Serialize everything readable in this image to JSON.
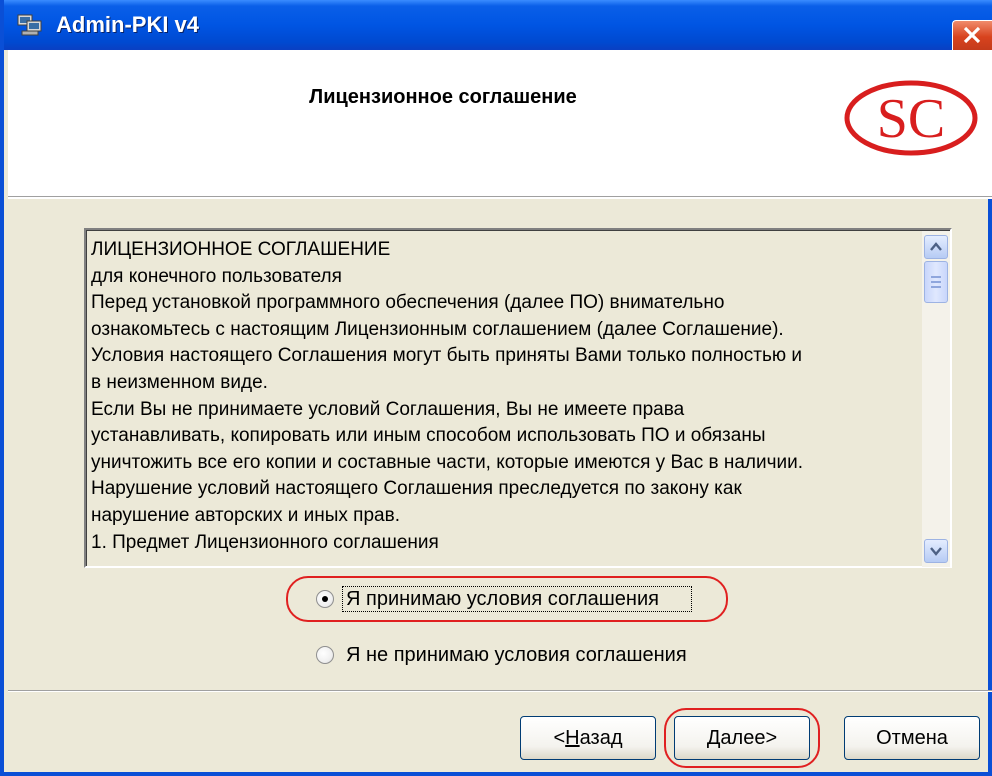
{
  "window": {
    "title": "Admin-PKI v4"
  },
  "header": {
    "title": "Лицензионное соглашение",
    "logo_text": "SC"
  },
  "license": {
    "lines": [
      "ЛИЦЕНЗИОННОЕ СОГЛАШЕНИЕ",
      "для конечного пользователя",
      "Перед установкой программного обеспечения (далее ПО) внимательно",
      "ознакомьтесь с настоящим Лицензионным соглашением (далее Соглашение).",
      "Условия настоящего Соглашения могут быть приняты Вами только полностью и",
      "в неизменном виде.",
      "Если Вы не принимаете условий Соглашения, Вы не имеете права",
      "устанавливать, копировать или иным способом использовать ПО и обязаны",
      "уничтожить все его копии и составные части, которые имеются у Вас в наличии.",
      "Нарушение условий настоящего Соглашения преследуется по закону как",
      "нарушение авторских и иных прав.",
      "1. Предмет Лицензионного соглашения"
    ]
  },
  "options": {
    "accept_label": "Я принимаю условия соглашения",
    "decline_label": "Я не принимаю условия соглашения",
    "selected": "accept"
  },
  "buttons": {
    "back_prefix": "<",
    "back_mnemonic": "Н",
    "back_rest": "азад",
    "next_mnemonic": "Д",
    "next_rest": "алее>",
    "cancel_label": "Отмена"
  },
  "colors": {
    "titlebar": "#0055E3",
    "dialog_bg": "#ECE9D8",
    "highlight": "#E02020",
    "logo": "#D81E1E"
  }
}
